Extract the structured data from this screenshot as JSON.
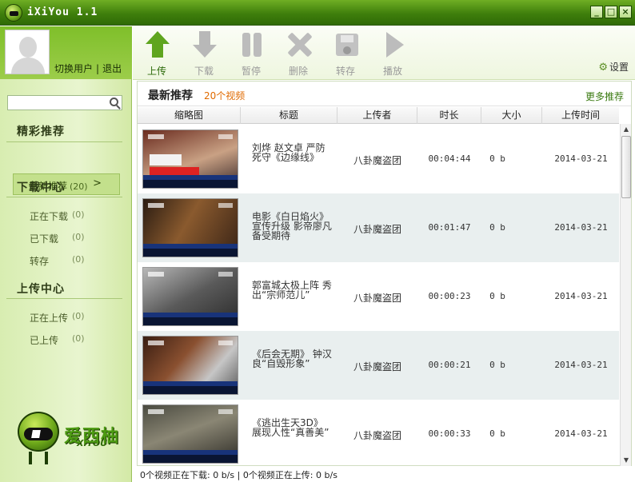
{
  "window": {
    "title": "iXiYou 1.1",
    "controls": [
      "_",
      "□",
      "×"
    ]
  },
  "user": {
    "switch_label": "切换用户",
    "separator": "|",
    "logout_label": "退出"
  },
  "search": {
    "placeholder": "",
    "value": ""
  },
  "sidebar": {
    "featured_title": "精彩推荐",
    "featured_items": [
      {
        "label": "最新推荐",
        "count": "(20)",
        "chevron": ">"
      }
    ],
    "download_title": "下载中心",
    "download_items": [
      {
        "label": "正在下载",
        "count": "(0)"
      },
      {
        "label": "已下载",
        "count": "(0)"
      },
      {
        "label": "转存",
        "count": "(0)"
      }
    ],
    "upload_title": "上传中心",
    "upload_items": [
      {
        "label": "正在上传",
        "count": "(0)"
      },
      {
        "label": "已上传",
        "count": "(0)"
      }
    ],
    "brand_cn": "爱西柚",
    "brand_en": "XiYOU"
  },
  "toolbar": {
    "buttons": [
      {
        "label": "上传",
        "icon": "upload-icon",
        "enabled": true
      },
      {
        "label": "下载",
        "icon": "download-icon",
        "enabled": false
      },
      {
        "label": "暂停",
        "icon": "pause-icon",
        "enabled": false
      },
      {
        "label": "删除",
        "icon": "delete-icon",
        "enabled": false
      },
      {
        "label": "转存",
        "icon": "save-icon",
        "enabled": false
      },
      {
        "label": "播放",
        "icon": "play-icon",
        "enabled": false
      }
    ],
    "settings_label": "设置"
  },
  "panel": {
    "title": "最新推荐",
    "count_label": "20个视频",
    "more_label": "更多推荐",
    "columns": [
      "缩略图",
      "标题",
      "上传者",
      "时长",
      "大小",
      "上传时间"
    ],
    "rows": [
      {
        "title": "刘烨 赵文卓 严防死守《边缘线》",
        "uploader": "八卦魔盗团",
        "duration": "00:04:44",
        "size": "0 b",
        "date": "2014-03-21"
      },
      {
        "title": "电影《白日焰火》宣传升级 影帝廖凡备受期待",
        "uploader": "八卦魔盗团",
        "duration": "00:01:47",
        "size": "0 b",
        "date": "2014-03-21"
      },
      {
        "title": "郭富城太极上阵 秀出“宗师范儿”",
        "uploader": "八卦魔盗团",
        "duration": "00:00:23",
        "size": "0 b",
        "date": "2014-03-21"
      },
      {
        "title": "《后会无期》 钟汉良“自毁形象”",
        "uploader": "八卦魔盗团",
        "duration": "00:00:21",
        "size": "0 b",
        "date": "2014-03-21"
      },
      {
        "title": "《逃出生天3D》 展现人性“真善美”",
        "uploader": "八卦魔盗团",
        "duration": "00:00:33",
        "size": "0 b",
        "date": "2014-03-21"
      }
    ]
  },
  "status": {
    "text": "0个视频正在下载: 0 b/s  |  0个视频正在上传: 0 b/s"
  },
  "colors": {
    "accent": "#5fa51e",
    "count_orange": "#e06a00",
    "link_green": "#3a7a10",
    "titlebar": "#3f7f0c"
  }
}
